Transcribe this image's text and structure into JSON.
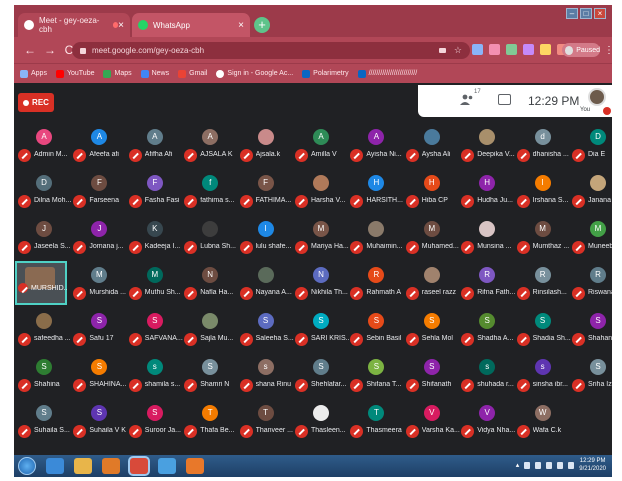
{
  "browser": {
    "tabs": [
      {
        "title": "Meet - gey-oeza-cbh",
        "close": "×"
      },
      {
        "title": "WhatsApp",
        "close": "×"
      }
    ],
    "new_tab": "+",
    "window_buttons": [
      "–",
      "□",
      "×"
    ],
    "url": "meet.google.com/gey-oeza-cbh",
    "profile_status": "Paused",
    "nav": {
      "back": "←",
      "forward": "→",
      "reload": "C"
    },
    "bookmarks": [
      "Apps",
      "YouTube",
      "Maps",
      "News",
      "Gmail",
      "Sign in - Google Ac...",
      "Polarimetry",
      "/////////////////////////"
    ]
  },
  "meet": {
    "rec_label": "REC",
    "participant_count": "17",
    "time": "12:29 PM",
    "you_label": "You",
    "participants": [
      [
        {
          "initial": "A",
          "color": "#e8477f",
          "name": "Admin M..."
        },
        {
          "initial": "A",
          "color": "#1e88e5",
          "name": "Afeefa afi"
        },
        {
          "initial": "A",
          "color": "#607d8b",
          "name": "Afifha Afi"
        },
        {
          "initial": "A",
          "color": "#8d6e63",
          "name": "AJSALA K"
        },
        {
          "initial": "",
          "color": "#c98a8a",
          "name": "Ajsala.k"
        },
        {
          "initial": "A",
          "color": "#2e8b57",
          "name": "Amilla V"
        },
        {
          "initial": "A",
          "color": "#8e24aa",
          "name": "Ayisha Ni..."
        },
        {
          "initial": "",
          "color": "#4a7a9c",
          "name": "Aysha Ali"
        },
        {
          "initial": "",
          "color": "#a88f6b",
          "name": "Deepika V..."
        },
        {
          "initial": "d",
          "color": "#78909c",
          "name": "dhanisha ..."
        },
        {
          "initial": "D",
          "color": "#00897b",
          "name": "Dia E"
        }
      ],
      [
        {
          "initial": "D",
          "color": "#546e7a",
          "name": "Dilna Moh..."
        },
        {
          "initial": "F",
          "color": "#6d4c41",
          "name": "Farseena"
        },
        {
          "initial": "F",
          "color": "#7e57c2",
          "name": "Fasha Fasi"
        },
        {
          "initial": "f",
          "color": "#00897b",
          "name": "fathima s..."
        },
        {
          "initial": "F",
          "color": "#795548",
          "name": "FATHIMA..."
        },
        {
          "initial": "",
          "color": "#b07a5a",
          "name": "Harsha V..."
        },
        {
          "initial": "H",
          "color": "#1e88e5",
          "name": "HARSITH..."
        },
        {
          "initial": "H",
          "color": "#e64a19",
          "name": "Hiba CP"
        },
        {
          "initial": "H",
          "color": "#8e24aa",
          "name": "Hudha Ju..."
        },
        {
          "initial": "I",
          "color": "#f57c00",
          "name": "Irshana S..."
        },
        {
          "initial": "",
          "color": "#c4a57a",
          "name": "Janana S..."
        }
      ],
      [
        {
          "initial": "J",
          "color": "#6d4c41",
          "name": "Jaseela S..."
        },
        {
          "initial": "J",
          "color": "#8e24aa",
          "name": "Jomana j..."
        },
        {
          "initial": "K",
          "color": "#37474f",
          "name": "Kadeeja I..."
        },
        {
          "initial": "",
          "color": "#3d3d3d",
          "name": "Lubna Sh..."
        },
        {
          "initial": "l",
          "color": "#1e88e5",
          "name": "lulu shafe..."
        },
        {
          "initial": "M",
          "color": "#795548",
          "name": "Mariya Ha..."
        },
        {
          "initial": "",
          "color": "#8a7a6a",
          "name": "Muhaimin..."
        },
        {
          "initial": "M",
          "color": "#6d4c41",
          "name": "Muhamed..."
        },
        {
          "initial": "",
          "color": "#d8c4c4",
          "name": "Munsina ..."
        },
        {
          "initial": "M",
          "color": "#6d4c41",
          "name": "Mumthaz ..."
        },
        {
          "initial": "M",
          "color": "#43a047",
          "name": "Muneeba ..."
        }
      ],
      [
        {
          "initial": "",
          "color": "",
          "name": "MURSHID..."
        },
        {
          "initial": "M",
          "color": "#607d8b",
          "name": "Murshida ..."
        },
        {
          "initial": "M",
          "color": "#00695c",
          "name": "Muthu Sh..."
        },
        {
          "initial": "N",
          "color": "#6d4c41",
          "name": "Nafla Ha..."
        },
        {
          "initial": "",
          "color": "#5a6a5a",
          "name": "Nayana A..."
        },
        {
          "initial": "N",
          "color": "#5c6bc0",
          "name": "Nikhila Th..."
        },
        {
          "initial": "R",
          "color": "#e64a19",
          "name": "Rahmath A"
        },
        {
          "initial": "",
          "color": "#a0826d",
          "name": "raseel razz"
        },
        {
          "initial": "R",
          "color": "#7e57c2",
          "name": "Rifna Fath..."
        },
        {
          "initial": "R",
          "color": "#78909c",
          "name": "Rinsilash..."
        },
        {
          "initial": "R",
          "color": "#607d8b",
          "name": "Riswana ..."
        }
      ],
      [
        {
          "initial": "",
          "color": "#8a6d4a",
          "name": "safeedha ..."
        },
        {
          "initial": "S",
          "color": "#8e24aa",
          "name": "Safu 17"
        },
        {
          "initial": "S",
          "color": "#d81b60",
          "name": "SAFVANA..."
        },
        {
          "initial": "",
          "color": "#7a8a6a",
          "name": "Sajla Mu..."
        },
        {
          "initial": "S",
          "color": "#5c6bc0",
          "name": "Saleeha S..."
        },
        {
          "initial": "S",
          "color": "#00acc1",
          "name": "SARI KRIS..."
        },
        {
          "initial": "S",
          "color": "#e64a19",
          "name": "Sebin Basil"
        },
        {
          "initial": "S",
          "color": "#f57c00",
          "name": "Sehla Mol"
        },
        {
          "initial": "S",
          "color": "#558b2f",
          "name": "Shadha A..."
        },
        {
          "initial": "S",
          "color": "#00897b",
          "name": "Shadia Sh..."
        },
        {
          "initial": "S",
          "color": "#8e24aa",
          "name": "Shahana ..."
        }
      ],
      [
        {
          "initial": "S",
          "color": "#2e7d32",
          "name": "Shahina"
        },
        {
          "initial": "S",
          "color": "#f57c00",
          "name": "SHAHINA..."
        },
        {
          "initial": "s",
          "color": "#00897b",
          "name": "shamila s..."
        },
        {
          "initial": "S",
          "color": "#78909c",
          "name": "Shamri N"
        },
        {
          "initial": "s",
          "color": "#8d6e63",
          "name": "shana Rinu"
        },
        {
          "initial": "S",
          "color": "#607d8b",
          "name": "Shehlafar..."
        },
        {
          "initial": "S",
          "color": "#7cb342",
          "name": "Shifana T..."
        },
        {
          "initial": "S",
          "color": "#8e24aa",
          "name": "Shifanath"
        },
        {
          "initial": "s",
          "color": "#00695c",
          "name": "shuhada r..."
        },
        {
          "initial": "s",
          "color": "#5e35b1",
          "name": "sinsha ibr..."
        },
        {
          "initial": "S",
          "color": "#78909c",
          "name": "Sriha Izaa"
        }
      ],
      [
        {
          "initial": "S",
          "color": "#607d8b",
          "name": "Suhaila S..."
        },
        {
          "initial": "S",
          "color": "#5e35b1",
          "name": "Suhaila V K"
        },
        {
          "initial": "S",
          "color": "#d81b60",
          "name": "Suroor Ja..."
        },
        {
          "initial": "T",
          "color": "#f57c00",
          "name": "Thafa Be..."
        },
        {
          "initial": "T",
          "color": "#6d4c41",
          "name": "Thanveer ..."
        },
        {
          "initial": "",
          "color": "#ececec",
          "name": "Thasleen..."
        },
        {
          "initial": "T",
          "color": "#00897b",
          "name": "Thasmeera"
        },
        {
          "initial": "V",
          "color": "#d81b60",
          "name": "Varsha Ka..."
        },
        {
          "initial": "V",
          "color": "#8e24aa",
          "name": "Vidya Nha..."
        },
        {
          "initial": "W",
          "color": "#8d6e63",
          "name": "Wafa C.k"
        }
      ]
    ]
  },
  "taskbar": {
    "apps": [
      {
        "icon": "internet-explorer-icon",
        "color": "#3b8ad8"
      },
      {
        "icon": "file-explorer-icon",
        "color": "#e8b54a"
      },
      {
        "icon": "media-player-icon",
        "color": "#e07a28"
      },
      {
        "icon": "chrome-icon",
        "color": "#d84a3a"
      },
      {
        "icon": "chrome-alt-icon",
        "color": "#4aa0e0"
      },
      {
        "icon": "firefox-icon",
        "color": "#e8782a"
      }
    ],
    "time": "12:29 PM",
    "date": "9/21/2020"
  },
  "colors": {
    "tab_strip": "#9c3a4a",
    "toolbar": "#b14757",
    "meet_bg": "#202124",
    "mute_red": "#d93025",
    "self_border": "#4fd1c5"
  }
}
